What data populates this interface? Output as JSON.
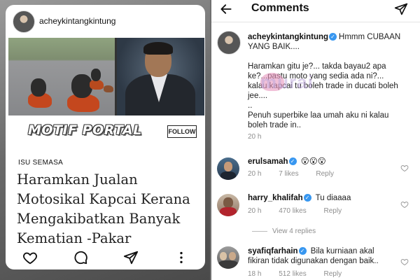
{
  "post_card": {
    "username": "acheykintangkintung",
    "brand_logo": "MOTIF PORTAL",
    "follow_label": "FOLLOW",
    "category": "ISU SEMASA",
    "headline_lines": [
      "Haramkan Jualan",
      "Motosikal Kapcai Kerana",
      "Mengakibatkan Banyak",
      "Kematian -Pakar"
    ],
    "actions": [
      "heart-icon",
      "comment-icon",
      "share-icon",
      "more-icon"
    ]
  },
  "comments_screen": {
    "title": "Comments",
    "icons": {
      "back": "arrow-left-icon",
      "send": "send-icon"
    },
    "caption": {
      "username": "acheykintangkintung",
      "verified": true,
      "lines": [
        "Hmmm CUBAAN",
        "YANG BAIK....",
        "",
        "Haramkan gitu je?... takda bayau2 apa",
        "ke?...pastu moto yang sedia ada ni?...",
        "kalau kapcai tu boleh trade in ducati boleh",
        "jee....",
        "..",
        "Penuh superbike laa umah aku ni kalau",
        "boleh trade in.."
      ],
      "time": "20 h"
    },
    "comments": [
      {
        "username": "erulsamah",
        "verified": true,
        "text": "😮😮😮",
        "time": "20 h",
        "likes": "7 likes",
        "reply_label": "Reply"
      },
      {
        "username": "harry_khalifah",
        "verified": true,
        "text": "Tu diaaaa",
        "time": "20 h",
        "likes": "470 likes",
        "reply_label": "Reply",
        "view_replies": "View 4 replies"
      },
      {
        "username": "syafiqfarhain",
        "verified": true,
        "text_lines": [
          "Bila kurniaan akal",
          "fikiran tidak digunakan dengan baik.."
        ],
        "time": "18 h",
        "likes": "512 likes",
        "reply_label": "Reply"
      }
    ]
  },
  "watermark": "murai",
  "colors": {
    "verified": "#3897f0",
    "meta_gray": "#8e8e8e",
    "text": "#222222"
  }
}
